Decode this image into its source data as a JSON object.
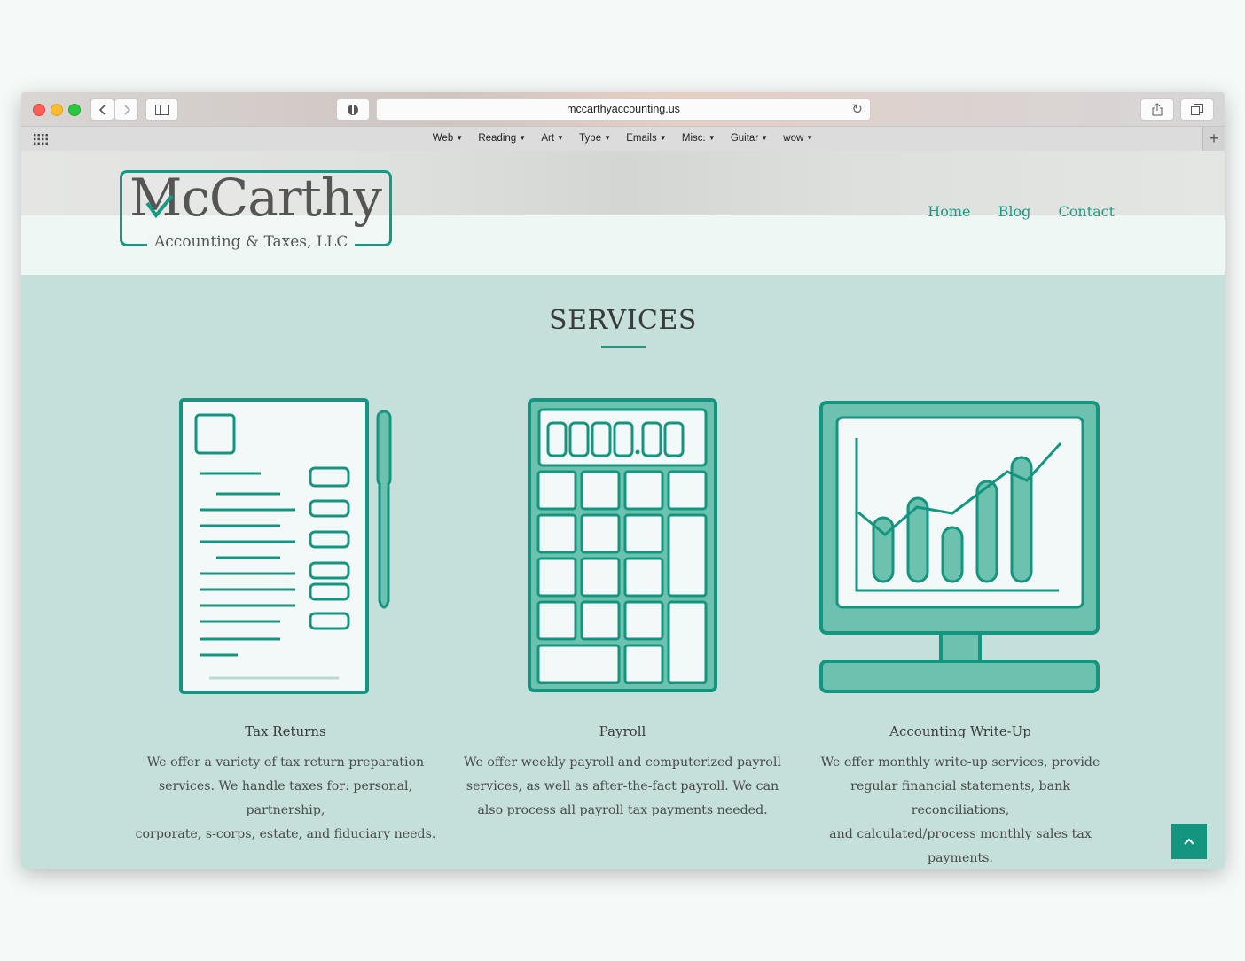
{
  "browser": {
    "url": "mccarthyaccounting.us",
    "bookmarks": [
      "Web",
      "Reading",
      "Art",
      "Type",
      "Emails",
      "Misc.",
      "Guitar",
      "wow"
    ]
  },
  "site": {
    "logo_main": "McCarthy",
    "logo_sub": "Accounting & Taxes, LLC",
    "nav": [
      "Home",
      "Blog",
      "Contact"
    ]
  },
  "services": {
    "title": "SERVICES",
    "items": [
      {
        "title": "Tax Returns",
        "lines": [
          "We offer a variety of tax return preparation",
          "services. We handle taxes for: personal, partnership,",
          "corporate, s-corps, estate, and fiduciary needs."
        ]
      },
      {
        "title": "Payroll",
        "lines": [
          "We offer weekly payroll and computerized payroll",
          "services, as well as after-the-fact payroll. We can",
          "also process all payroll tax payments needed."
        ]
      },
      {
        "title": "Accounting Write-Up",
        "lines": [
          "We offer monthly write-up services, provide",
          "regular financial statements, bank reconciliations,",
          "and calculated/process monthly sales tax payments."
        ]
      }
    ]
  },
  "colors": {
    "accent": "#1a9b86",
    "background": "#c5e0da",
    "icon_fill": "#6cc2ae"
  }
}
